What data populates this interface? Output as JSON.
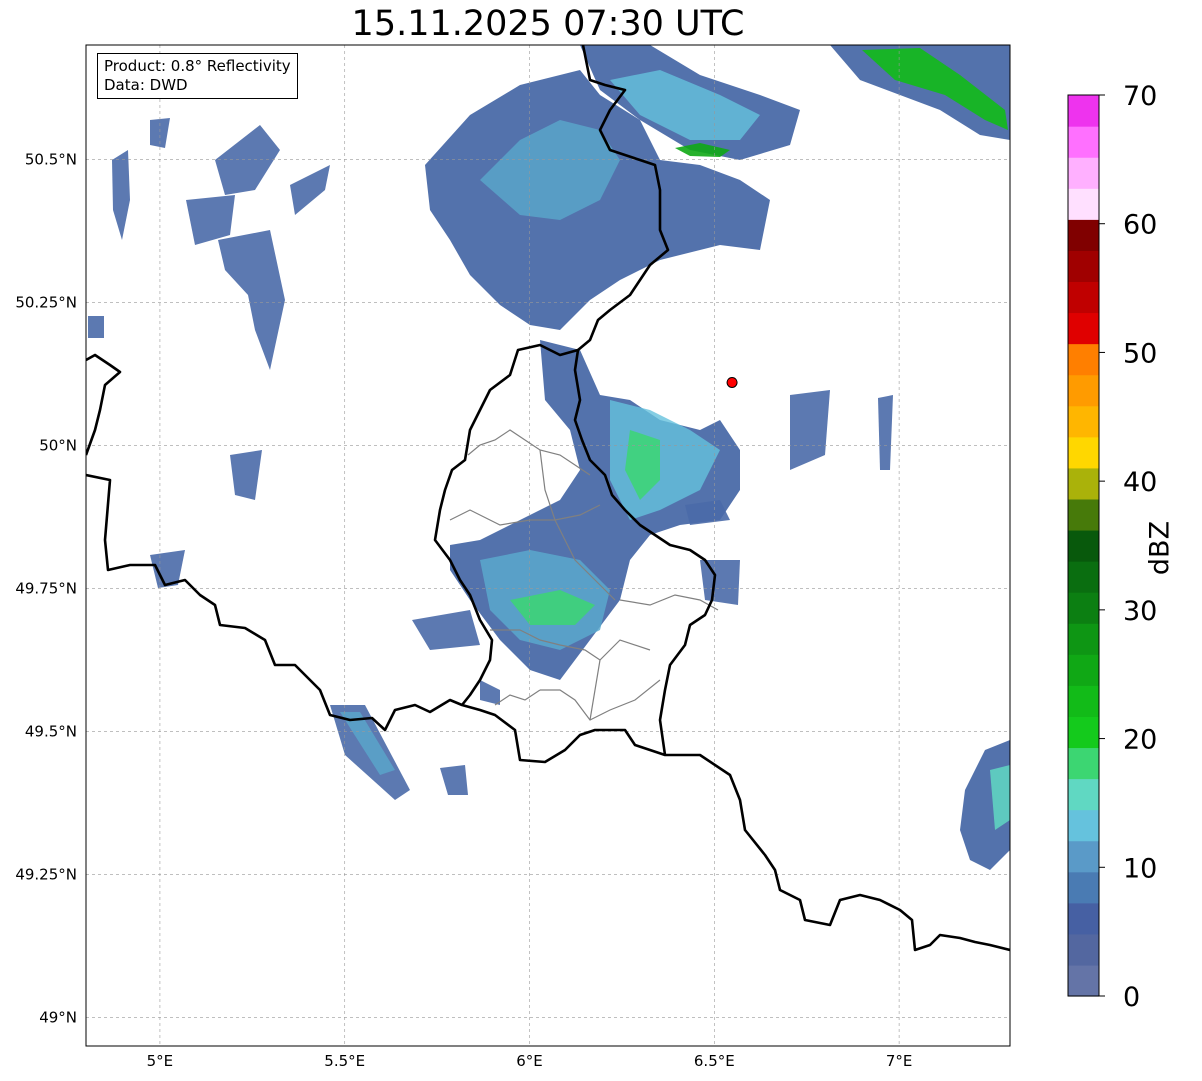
{
  "title": "15.11.2025 07:30 UTC",
  "info": {
    "product": "Product: 0.8° Reflectivity",
    "data": "Data: DWD"
  },
  "map": {
    "lon_range": [
      4.8,
      7.3
    ],
    "lat_range": [
      48.95,
      50.7
    ],
    "lon_ticks": [
      {
        "value": 5.0,
        "label": "5°E"
      },
      {
        "value": 5.5,
        "label": "5.5°E"
      },
      {
        "value": 6.0,
        "label": "6°E"
      },
      {
        "value": 6.5,
        "label": "6.5°E"
      },
      {
        "value": 7.0,
        "label": "7°E"
      }
    ],
    "lat_ticks": [
      {
        "value": 49.0,
        "label": "49°N"
      },
      {
        "value": 49.25,
        "label": "49.25°N"
      },
      {
        "value": 49.5,
        "label": "49.5°N"
      },
      {
        "value": 49.75,
        "label": "49.75°N"
      },
      {
        "value": 50.0,
        "label": "50°N"
      },
      {
        "value": 50.25,
        "label": "50.25°N"
      },
      {
        "value": 50.5,
        "label": "50.5°N"
      }
    ],
    "grid": true,
    "radar_site": {
      "lon": 6.548,
      "lat": 50.11,
      "color": "#ff0000"
    }
  },
  "colorbar": {
    "label": "dBZ",
    "min": 0,
    "max": 70,
    "ticks": [
      {
        "value": 0,
        "label": "0"
      },
      {
        "value": 10,
        "label": "10"
      },
      {
        "value": 20,
        "label": "20"
      },
      {
        "value": 30,
        "label": "30"
      },
      {
        "value": 40,
        "label": "40"
      },
      {
        "value": 50,
        "label": "50"
      },
      {
        "value": 60,
        "label": "60"
      },
      {
        "value": 70,
        "label": "70"
      }
    ],
    "colors": [
      "#6474a7",
      "#5367a0",
      "#4660a3",
      "#4a7bb3",
      "#5a9ac8",
      "#65c2dd",
      "#60d8c2",
      "#3cd672",
      "#14ca1c",
      "#12bb18",
      "#10a815",
      "#0e9614",
      "#0c7f12",
      "#0a6e10",
      "#08590c",
      "#477a0a",
      "#aab20a",
      "#ffd700",
      "#ffb600",
      "#ff9b00",
      "#ff7f00",
      "#e00000",
      "#c00000",
      "#a00000",
      "#800000",
      "#ffe0ff",
      "#ffb0ff",
      "#ff70ff",
      "#ee33ee"
    ]
  }
}
